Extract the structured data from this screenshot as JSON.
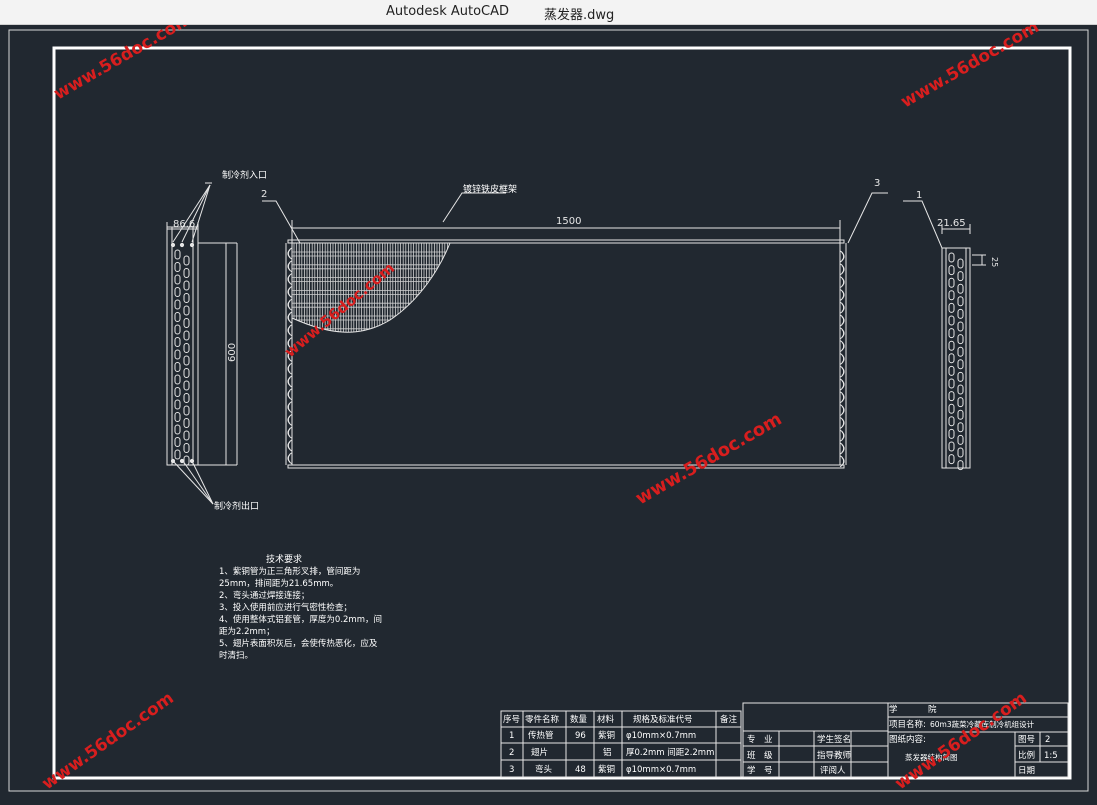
{
  "window": {
    "app_name": "Autodesk AutoCAD",
    "file_name": "蒸发器.dwg"
  },
  "drawing": {
    "dims": {
      "length_1500": "1500",
      "height_600": "600",
      "left_width": "86.6",
      "right_width": "21.65",
      "right_small": "25"
    },
    "callouts": {
      "refrigerant_inlet": "制冷剂入口",
      "refrigerant_outlet": "制冷剂出口",
      "frame": "镀锌铁皮框架",
      "num_1": "1",
      "num_2": "2",
      "num_3": "3"
    },
    "tech_requirements": {
      "title": "技术要求",
      "lines": [
        "1、紫铜管为正三角形叉排，管间距为",
        "25mm，排间距为21.65mm。",
        "2、弯头通过焊接连接；",
        "3、投入使用前应进行气密性检查；",
        "4、使用整体式铝套管，厚度为0.2mm，间",
        "距为2.2mm；",
        "5、翅片表面积灰后，会使传热恶化，应及",
        "时清扫。"
      ]
    },
    "parts_table": {
      "headers": [
        "序号",
        "零件名称",
        "数量",
        "材料",
        "规格及标准代号",
        "备注"
      ],
      "rows": [
        [
          "1",
          "传热管",
          "96",
          "紫铜",
          "φ10mm×0.7mm",
          ""
        ],
        [
          "2",
          "翅片",
          "",
          "铝",
          "厚0.2mm 间距2.2mm",
          ""
        ],
        [
          "3",
          "弯头",
          "48",
          "紫铜",
          "φ10mm×0.7mm",
          ""
        ]
      ]
    },
    "title_block": {
      "college_label": "学",
      "college_label2": "院",
      "project_label": "项目名称:",
      "project_value": "60m3蔬菜冷藏库制冷机组设计",
      "drawing_content_label": "图纸内容:",
      "drawing_content_value": "蒸发器结构简图",
      "major_label": "专",
      "major_label2": "业",
      "class_label": "班",
      "class_label2": "级",
      "student_id_label": "学",
      "student_id_label2": "号",
      "student_sign": "学生签名",
      "advisor_sign": "指导教师",
      "reviewer": "评阅人",
      "sheet_label": "图号",
      "sheet_value": "2",
      "scale_label": "比例",
      "scale_value": "1:5",
      "date_label": "日期"
    },
    "watermark": "www.56doc.com"
  }
}
